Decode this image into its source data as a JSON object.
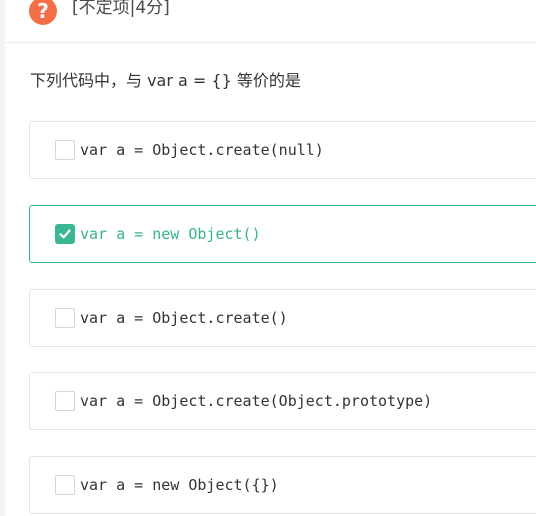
{
  "header": {
    "icon": "question-mark-icon",
    "icon_glyph": "?",
    "icon_color": "#f36d46",
    "question_type": "[不定项|4分]"
  },
  "question": {
    "text": "下列代码中，与 var a = {} 等价的是"
  },
  "accent_color": "#37b38f",
  "options": [
    {
      "text": "var a = Object.create(null)",
      "checked": false
    },
    {
      "text": "var a = new Object()",
      "checked": true
    },
    {
      "text": "var a = Object.create()",
      "checked": false
    },
    {
      "text": "var a = Object.create(Object.prototype)",
      "checked": false
    },
    {
      "text": "var a = new Object({})",
      "checked": false
    }
  ]
}
